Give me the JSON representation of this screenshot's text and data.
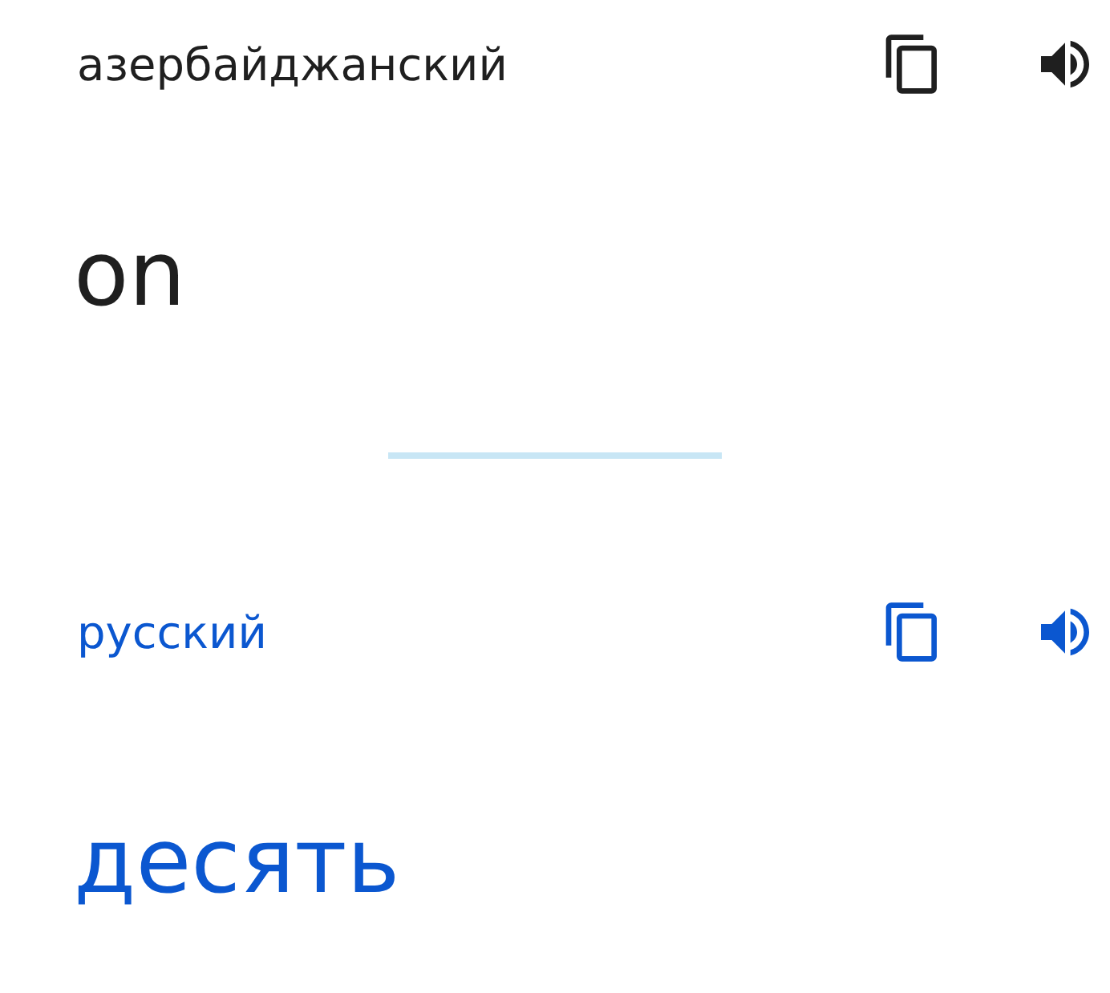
{
  "source": {
    "language": "азербайджанский",
    "text": "on"
  },
  "target": {
    "language": "русский",
    "text": "десять"
  }
}
